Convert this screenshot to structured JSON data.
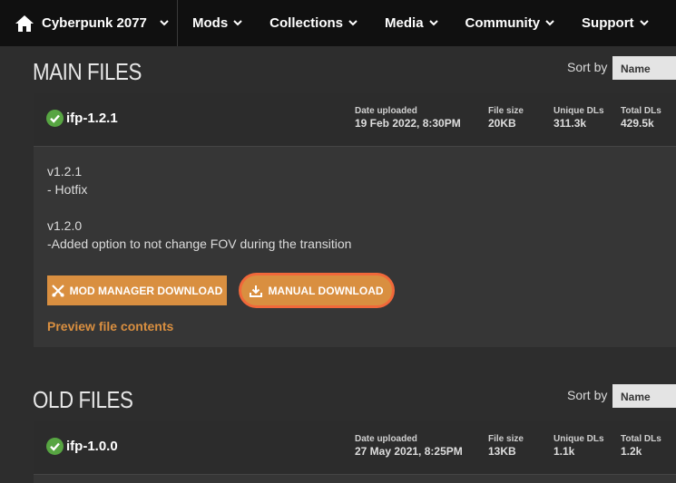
{
  "nav": {
    "game_title": "Cyberpunk 2077",
    "items": [
      {
        "label": "Mods"
      },
      {
        "label": "Collections"
      },
      {
        "label": "Media"
      },
      {
        "label": "Community"
      },
      {
        "label": "Support"
      }
    ]
  },
  "sections": {
    "main": {
      "title": "MAIN FILES",
      "sort_label": "Sort by",
      "sort_value": "Name"
    },
    "old": {
      "title": "OLD FILES",
      "sort_label": "Sort by",
      "sort_value": "Name"
    }
  },
  "stat_labels": {
    "date": "Date uploaded",
    "size": "File size",
    "unique": "Unique DLs",
    "total": "Total DLs"
  },
  "main_file": {
    "name": "ifp-1.2.1",
    "date": "19 Feb 2022, 8:30PM",
    "size": "20KB",
    "unique": "311.3k",
    "total": "429.5k",
    "description": "v1.2.1\n- Hotfix\n\nv1.2.0\n-Added option to not change FOV during the transition",
    "mod_manager_label": "MOD MANAGER DOWNLOAD",
    "manual_label": "MANUAL DOWNLOAD",
    "preview_label": "Preview file contents"
  },
  "old_file": {
    "name": "ifp-1.0.0",
    "date": "27 May 2021, 8:25PM",
    "size": "13KB",
    "unique": "1.1k",
    "total": "1.2k"
  },
  "colors": {
    "accent": "#d98f40",
    "highlight": "#f1683a",
    "check": "#57a542"
  }
}
